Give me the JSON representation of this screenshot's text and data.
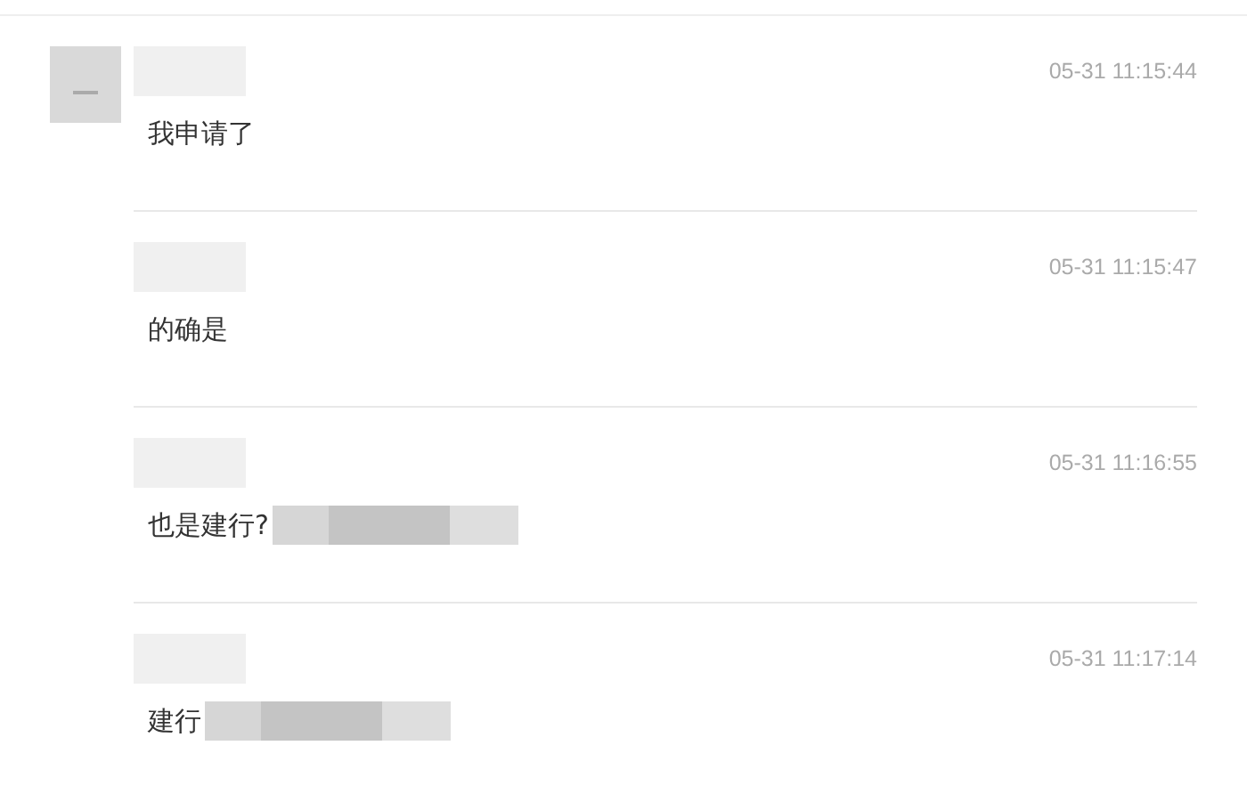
{
  "comments": [
    {
      "avatar": true,
      "name_redacted": true,
      "time": "05-31 11:15:44",
      "text": "我申请了",
      "text_redacted": false
    },
    {
      "avatar": false,
      "name_redacted": true,
      "time": "05-31 11:15:47",
      "text": "的确是",
      "text_redacted": false
    },
    {
      "avatar": false,
      "name_redacted": true,
      "time": "05-31 11:16:55",
      "text": "也是建行?",
      "text_redacted": true
    },
    {
      "avatar": false,
      "name_redacted": true,
      "time": "05-31 11:17:14",
      "text": "建行",
      "text_redacted": true
    }
  ]
}
